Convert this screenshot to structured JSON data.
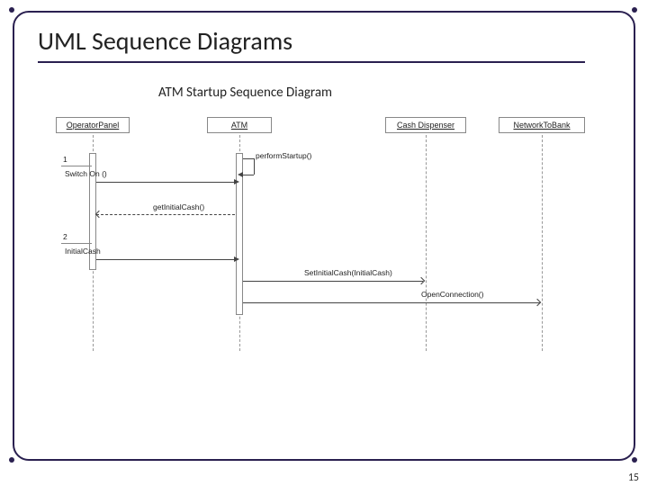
{
  "slide": {
    "title": "UML Sequence Diagrams",
    "subtitle": "ATM Startup Sequence Diagram",
    "page_number": "15"
  },
  "participants": {
    "operator_panel": "OperatorPanel",
    "atm": "ATM",
    "cash_dispenser": "Cash Dispenser",
    "network_to_bank": "NetworkToBank"
  },
  "messages": {
    "seq1": "1",
    "switch_on": "Switch On ()",
    "perform_startup": "performStartup()",
    "get_initial_cash": "getInitialCash()",
    "seq2": "2",
    "initial_cash": "InitialCash",
    "set_initial_cash": "SetInitialCash(InitialCash)",
    "open_connection": "OpenConnection()"
  }
}
